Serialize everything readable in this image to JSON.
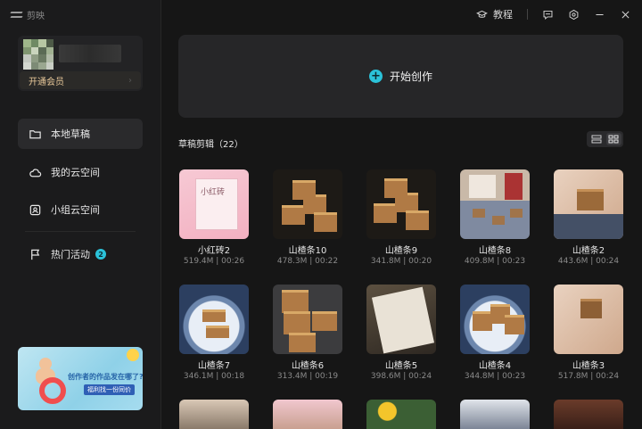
{
  "app": {
    "title": "剪映"
  },
  "topbar": {
    "tutorial": "教程"
  },
  "user": {
    "member_label": "开通会员"
  },
  "sidebar": {
    "items": [
      {
        "label": "本地草稿"
      },
      {
        "label": "我的云空间"
      },
      {
        "label": "小组云空间"
      },
      {
        "label": "热门活动",
        "badge": "2"
      }
    ]
  },
  "banner": {
    "title": "创作者的作品发在哪了?",
    "cta": "福利找一份同价"
  },
  "main": {
    "create_label": "开始创作",
    "drafts_title": "草稿剪辑（22）"
  },
  "drafts": [
    {
      "name": "小红砖2",
      "meta": "519.4M | 00:26",
      "thumb": "pink-box"
    },
    {
      "name": "山楂条10",
      "meta": "478.3M | 00:22",
      "thumb": "cubes-dark"
    },
    {
      "name": "山楂条9",
      "meta": "341.8M | 00:20",
      "thumb": "cubes-dark"
    },
    {
      "name": "山楂条8",
      "meta": "409.8M | 00:23",
      "thumb": "table-tray"
    },
    {
      "name": "山楂条2",
      "meta": "443.6M | 00:24",
      "thumb": "hand-hold"
    },
    {
      "name": "山楂条7",
      "meta": "346.1M | 00:18",
      "thumb": "plate"
    },
    {
      "name": "山楂条6",
      "meta": "313.4M | 00:19",
      "thumb": "stack-dark"
    },
    {
      "name": "山楂条5",
      "meta": "398.6M | 00:24",
      "thumb": "paper-box"
    },
    {
      "name": "山楂条4",
      "meta": "344.8M | 00:23",
      "thumb": "plate"
    },
    {
      "name": "山楂条3",
      "meta": "517.8M | 00:24",
      "thumb": "hand-hold"
    }
  ],
  "colors": {
    "accent": "#2bc2d9",
    "member": "#e8c89a"
  }
}
